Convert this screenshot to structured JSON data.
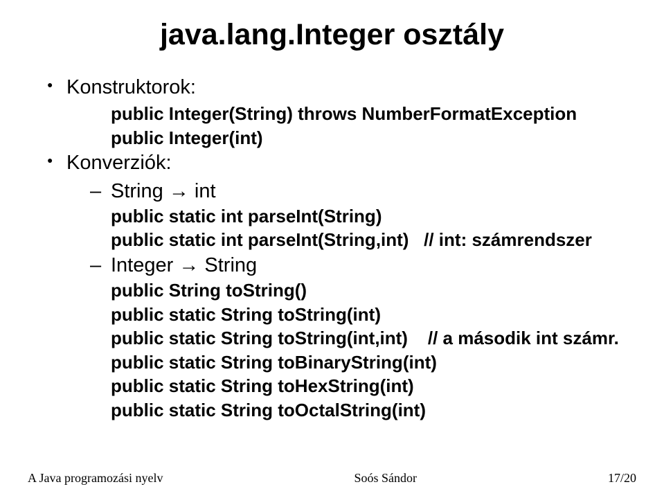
{
  "title": "java.lang.Integer osztály",
  "bullets": {
    "constructors": "Konstruktorok:",
    "conversions": "Konverziók:"
  },
  "code": {
    "ctor1": "public Integer(String) throws NumberFormatException",
    "ctor2": "public Integer(int)",
    "conv_string_int": "String → int",
    "parse1": "public static int parseInt(String)",
    "parse2": "public static int parseInt(String,int)   // int: számrendszer",
    "conv_integer_string": "Integer → String",
    "tostr1": "public String toString()",
    "tostr2": "public static String toString(int)",
    "tostr3": "public static String toString(int,int)    // a második int számr.",
    "tobin": "public static String toBinaryString(int)",
    "tohex": "public static String toHexString(int)",
    "tooct": "public static String toOctalString(int)"
  },
  "footer": {
    "left": "A Java programozási nyelv",
    "center": "Soós Sándor",
    "right": "17/20"
  }
}
